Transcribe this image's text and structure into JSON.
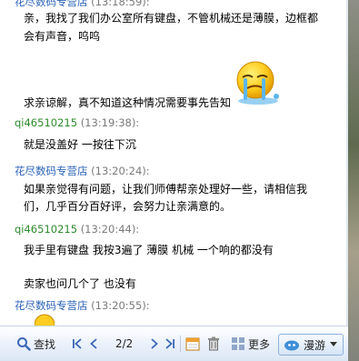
{
  "chat": {
    "top_partial_name": "花尽数码专营店",
    "top_partial_time": "(13:18:59):",
    "msg1_line1": "亲，我找了我们办公室所有键盘，不管机械还是薄膜，边框都",
    "msg1_line2": "会有声音，呜呜",
    "msg1_line3": "求亲谅解，真不知道这种情况需要事先告知",
    "h2_name": "qi46510215",
    "h2_time": "(13:19:38):",
    "msg2_line1": "就是没盖好 一按往下沉",
    "h3_name": "花尽数码专营店",
    "h3_time": "(13:20:24):",
    "msg3_line1": "如果亲觉得有问题，让我们师傅帮亲处理好一些，请相信我",
    "msg3_line2": "们，几乎百分百好评，会努力让亲满意的。",
    "h4_name": "qi46510215",
    "h4_time": "(13:20:44):",
    "msg4_line1": "我手里有键盘 我按3遍了 薄膜  机械  一个响的都没有",
    "msg4_line2": "卖家也问几个了  也没有",
    "h5_name": "花尽数码专营店",
    "h5_time": "(13:20:55):"
  },
  "toolbar": {
    "search_label": "查找",
    "page_indicator": "2/2",
    "more_label": "更多",
    "roam_label": "漫游"
  },
  "icons": {
    "search": "search-icon",
    "first": "first-page-icon",
    "prev": "prev-page-icon",
    "next": "next-page-icon",
    "last": "last-page-icon",
    "calendar": "calendar-icon",
    "delete": "trash-icon",
    "more": "more-icon",
    "roam": "cloud-icon",
    "emoji": "crying-face-emoji"
  },
  "colors": {
    "store_name": "#2a62b8",
    "buyer_name": "#2c8a2c",
    "time": "#7a7a7a"
  }
}
